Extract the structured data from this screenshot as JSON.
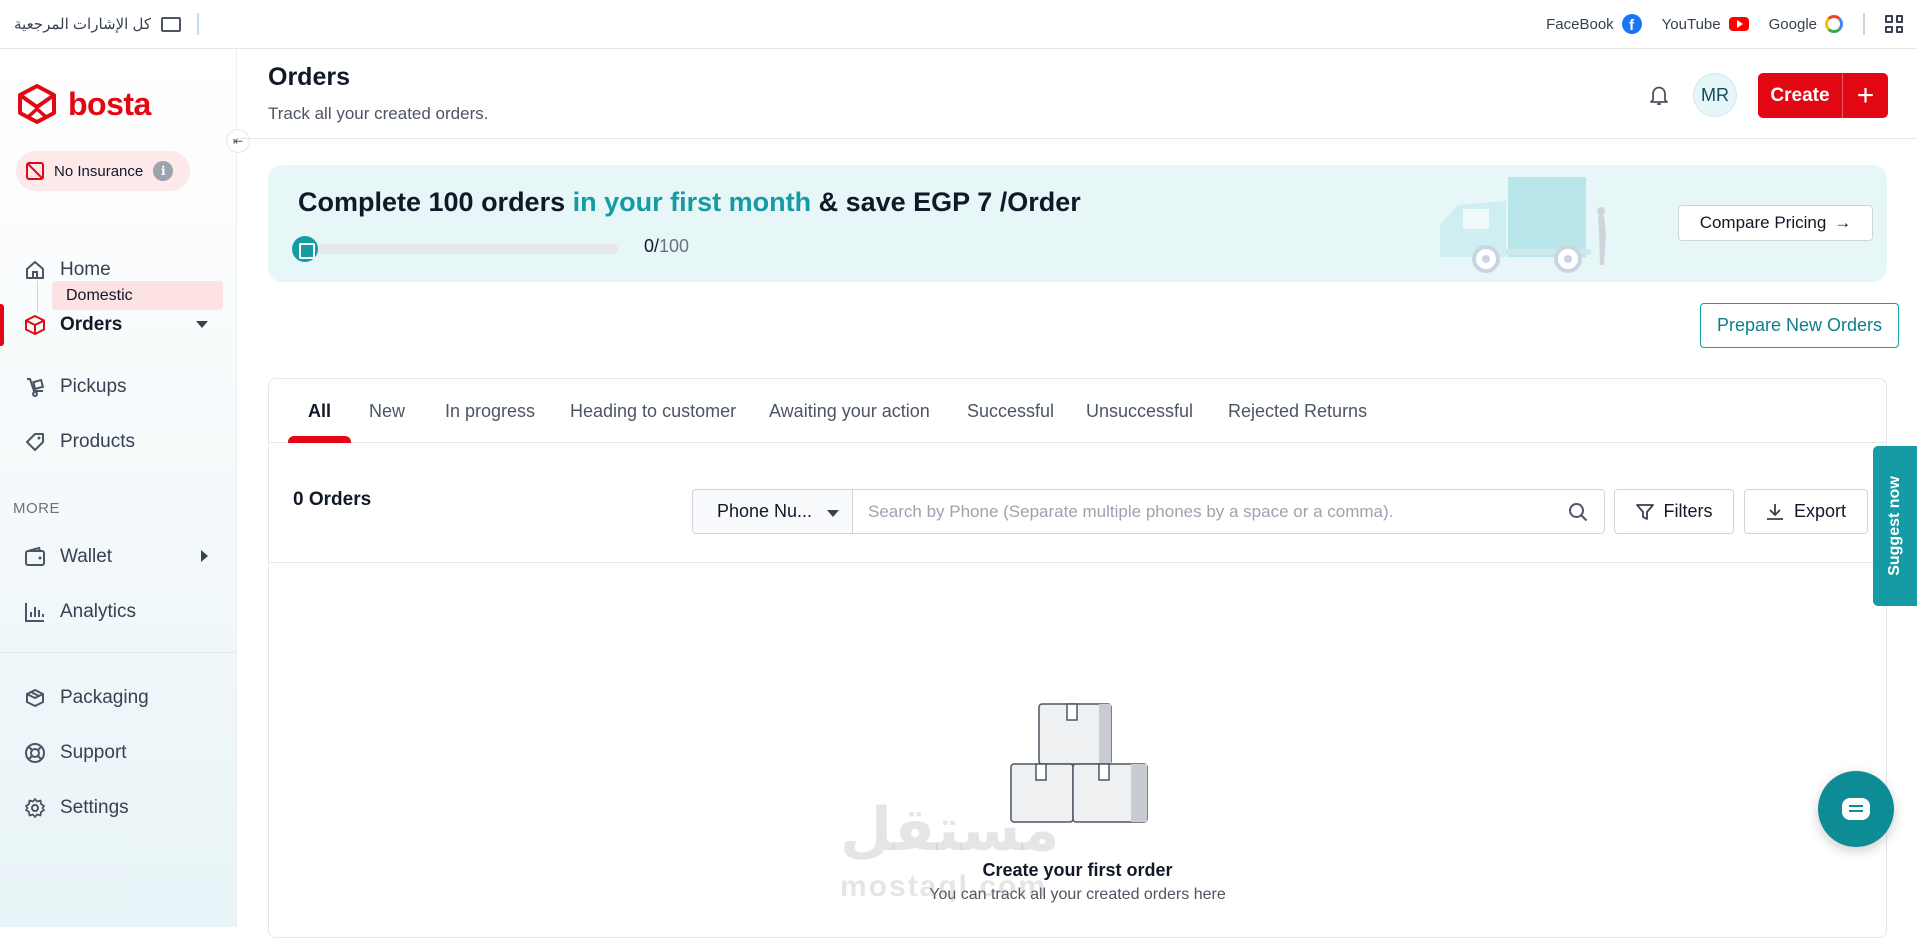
{
  "bookmarks": {
    "left_label": "كل الإشارات المرجعية",
    "items": [
      {
        "label": "FaceBook",
        "icon": "facebook-icon"
      },
      {
        "label": "YouTube",
        "icon": "youtube-icon"
      },
      {
        "label": "Google",
        "icon": "google-icon"
      }
    ]
  },
  "brand": {
    "name": "bosta",
    "color": "#e30613"
  },
  "insurance": {
    "label": "No Insurance",
    "info": "i"
  },
  "sidebar": {
    "items": [
      {
        "label": "Home",
        "icon": "home-icon"
      },
      {
        "label": "Orders",
        "icon": "orders-box-icon"
      },
      {
        "label": "Domestic"
      },
      {
        "label": "Pickups",
        "icon": "pickups-icon"
      },
      {
        "label": "Products",
        "icon": "tag-icon"
      },
      {
        "label": "Wallet",
        "icon": "wallet-icon"
      },
      {
        "label": "Analytics",
        "icon": "analytics-icon"
      },
      {
        "label": "Packaging",
        "icon": "packaging-icon"
      },
      {
        "label": "Support",
        "icon": "support-icon"
      },
      {
        "label": "Settings",
        "icon": "gear-icon"
      }
    ],
    "more_label": "MORE"
  },
  "header": {
    "title": "Orders",
    "subtitle": "Track all your created orders.",
    "avatar": "MR",
    "create_label": "Create",
    "create_plus": "+"
  },
  "promo": {
    "title_a": "Complete 100 orders ",
    "title_hl": "in your first month",
    "title_b": " & save EGP 7 /Order",
    "progress_done": "0",
    "progress_sep": "/",
    "progress_total": "100",
    "progress_fraction": 0,
    "compare_label": "Compare Pricing",
    "accent": "#149ba3"
  },
  "prepare_label": "Prepare New Orders",
  "tabs": [
    {
      "label": "All"
    },
    {
      "label": "New"
    },
    {
      "label": "In progress"
    },
    {
      "label": "Heading to customer"
    },
    {
      "label": "Awaiting your action"
    },
    {
      "label": "Successful"
    },
    {
      "label": "Unsuccessful"
    },
    {
      "label": "Rejected Returns"
    }
  ],
  "orders": {
    "count_label": "0 Orders",
    "filter_selected": "Phone Nu...",
    "search_placeholder": "Search by Phone (Separate multiple phones by a space or a comma).",
    "filters_label": "Filters",
    "export_label": "Export",
    "empty_title": "Create your first order",
    "empty_subtitle": "You can track all your created orders here"
  },
  "floating": {
    "suggest_label": "Suggest now"
  },
  "watermark": {
    "text": "مستقل",
    "sub": "mostaql.com"
  }
}
